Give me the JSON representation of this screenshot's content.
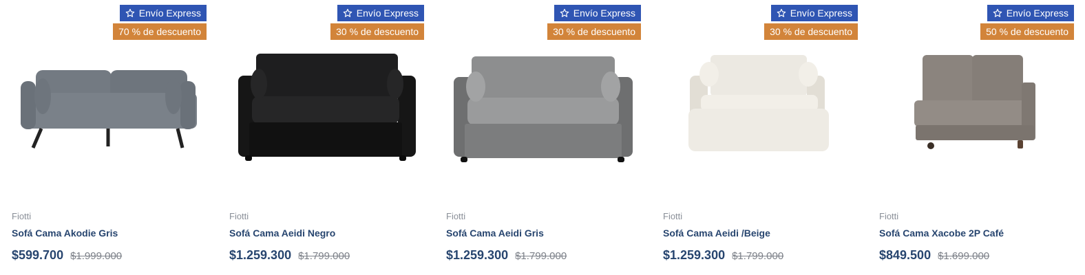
{
  "products": [
    {
      "express": "Envío Express",
      "discount": "70 % de descuento",
      "brand": "Fiotti",
      "name": "Sofá Cama Akodie Gris",
      "price": "$599.700",
      "old_price": "$1.999.000",
      "image": "gray-futon-sofa",
      "image_color": "#737a82"
    },
    {
      "express": "Envío Express",
      "discount": "30 % de descuento",
      "brand": "Fiotti",
      "name": "Sofá Cama Aeidi Negro",
      "price": "$1.259.300",
      "old_price": "$1.799.000",
      "image": "black-pullout-sofa",
      "image_color": "#1e1e1f"
    },
    {
      "express": "Envío Express",
      "discount": "30 % de descuento",
      "brand": "Fiotti",
      "name": "Sofá Cama Aeidi Gris",
      "price": "$1.259.300",
      "old_price": "$1.799.000",
      "image": "gray-pullout-sofa",
      "image_color": "#8d8e8f"
    },
    {
      "express": "Envío Express",
      "discount": "30 % de descuento",
      "brand": "Fiotti",
      "name": "Sofá Cama Aeidi /Beige",
      "price": "$1.259.300",
      "old_price": "$1.799.000",
      "image": "beige-pullout-sofa-extended",
      "image_color": "#ece9e2"
    },
    {
      "express": "Envío Express",
      "discount": "50 % de descuento",
      "brand": "Fiotti",
      "name": "Sofá Cama Xacobe 2P Café",
      "price": "$849.500",
      "old_price": "$1.699.000",
      "image": "brown-modular-loveseat",
      "image_color": "#8b847e"
    }
  ],
  "colors": {
    "express_badge": "#2f55b3",
    "discount_badge": "#d2843a",
    "title": "#27456f",
    "brand": "#8a8f98"
  }
}
